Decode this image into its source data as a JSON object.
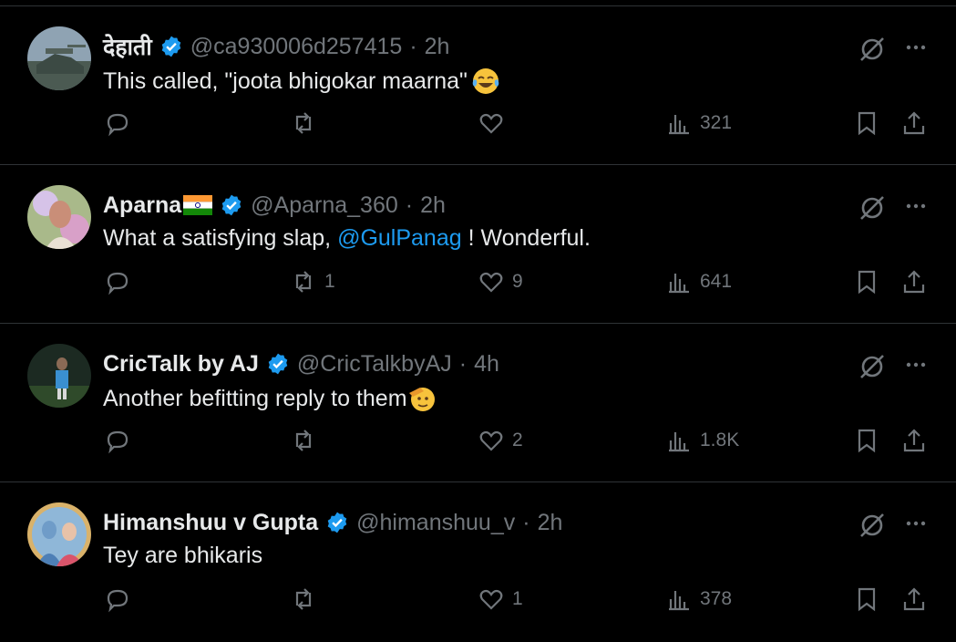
{
  "posts": [
    {
      "username": "देहाती",
      "handle": "@ca930006d257415",
      "separator": "·",
      "time": "2h",
      "text_parts": [
        "This called, \"joota bhigokar maarna\""
      ],
      "emoji": "face-with-tears-of-joy-icon",
      "reply_count": "",
      "repost_count": "",
      "like_count": "",
      "views": "321"
    },
    {
      "username": "Aparna",
      "has_flag": true,
      "handle": "@Aparna_360",
      "separator": "·",
      "time": "2h",
      "text_before": "What a satisfying slap, ",
      "mention": "@GulPanag",
      "text_after": " ! Wonderful.",
      "reply_count": "",
      "repost_count": "1",
      "like_count": "9",
      "views": "641"
    },
    {
      "username": "CricTalk by AJ",
      "handle": "@CricTalkbyAJ",
      "separator": "·",
      "time": "4h",
      "text_parts": [
        "Another befitting reply to them"
      ],
      "emoji": "saluting-face-icon",
      "reply_count": "",
      "repost_count": "",
      "like_count": "2",
      "views": "1.8K"
    },
    {
      "username": "Himanshuu v Gupta",
      "handle": "@himanshuu_v",
      "separator": "·",
      "time": "2h",
      "text_parts": [
        "Tey are bhikaris"
      ],
      "reply_count": "",
      "repost_count": "",
      "like_count": "1",
      "views": "378"
    }
  ],
  "colors": {
    "background": "#000000",
    "text": "#e7e9ea",
    "secondary": "#71767b",
    "accent": "#1d9bf0",
    "divider": "#2f3336"
  }
}
